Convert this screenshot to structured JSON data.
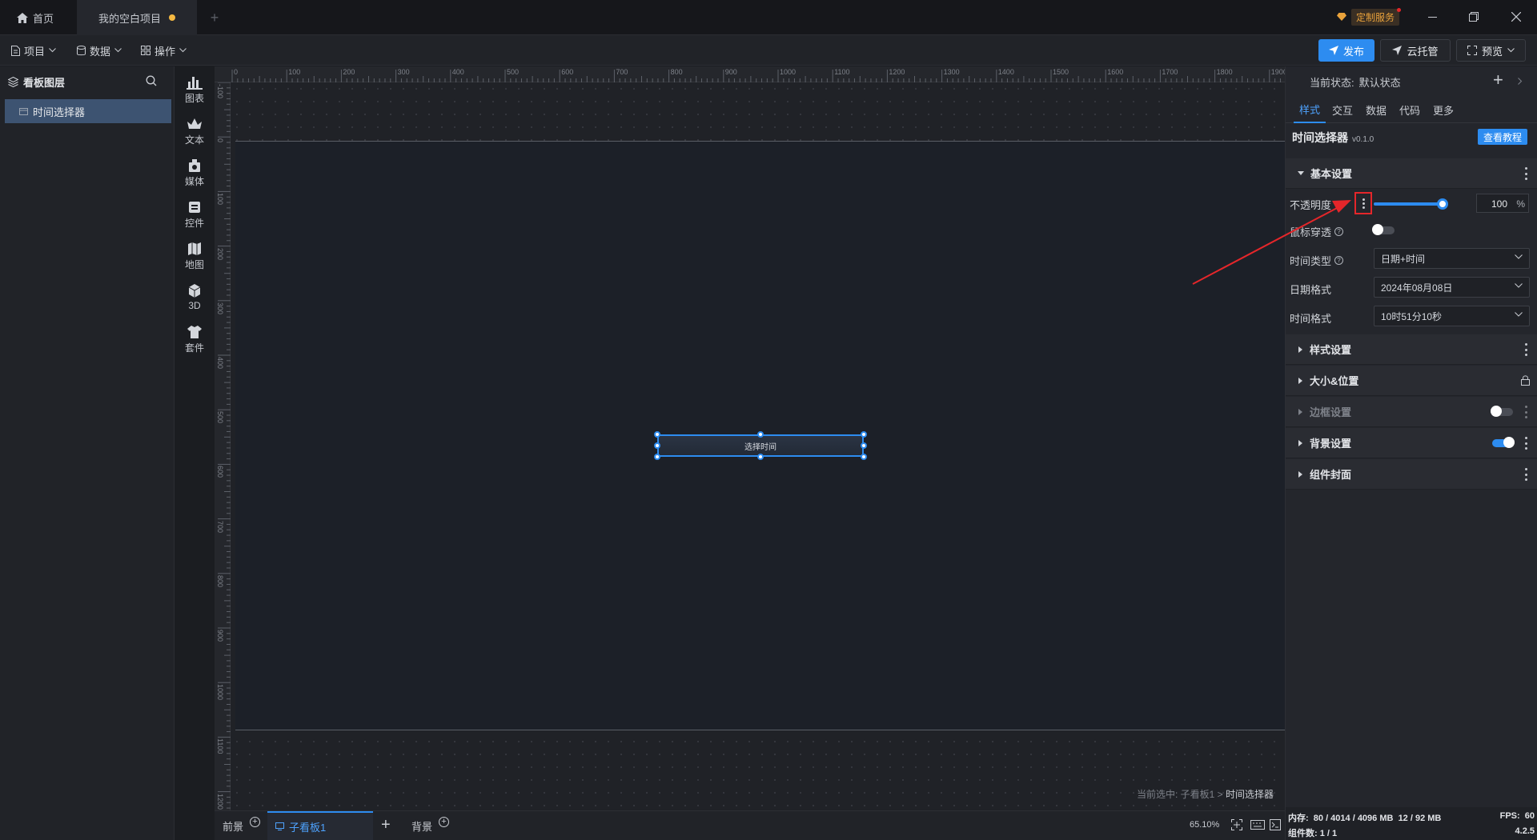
{
  "titlebar": {
    "tabs": [
      {
        "label": "首页"
      },
      {
        "label": "我的空白项目"
      }
    ],
    "custom_service": "定制服务"
  },
  "toolbar": {
    "menus": [
      {
        "label": "项目"
      },
      {
        "label": "数据"
      },
      {
        "label": "操作"
      }
    ],
    "publish": "发布",
    "cloud_host": "云托管",
    "preview": "预览"
  },
  "layers": {
    "title": "看板图层",
    "items": [
      {
        "label": "时间选择器"
      }
    ]
  },
  "tools": [
    {
      "label": "图表",
      "icon": "chart-icon"
    },
    {
      "label": "文本",
      "icon": "text-icon"
    },
    {
      "label": "媒体",
      "icon": "media-icon"
    },
    {
      "label": "控件",
      "icon": "control-icon"
    },
    {
      "label": "地图",
      "icon": "map-icon"
    },
    {
      "label": "3D",
      "icon": "cube-icon"
    },
    {
      "label": "套件",
      "icon": "kit-icon"
    }
  ],
  "ruler": {
    "top_ticks": [
      "0",
      "100",
      "200",
      "300",
      "400",
      "500",
      "600",
      "700",
      "800",
      "900",
      "1000",
      "1100",
      "1200",
      "1300",
      "1400",
      "1500",
      "1600",
      "1700",
      "1800",
      "1900"
    ],
    "left_ticks": [
      "-100",
      "0",
      "100",
      "200",
      "300",
      "400",
      "500",
      "600",
      "700",
      "800",
      "900",
      "1000",
      "1100",
      "1200"
    ]
  },
  "canvas": {
    "widget_text": "选择时间",
    "breadcrumb_prefix": "当前选中: 子看板1 > ",
    "breadcrumb_current": "时间选择器"
  },
  "bottombar": {
    "tabs": [
      {
        "label": "前景"
      },
      {
        "label": "子看板1"
      },
      {
        "label": "背景"
      }
    ],
    "zoom": "65.10%"
  },
  "right": {
    "state_label": "当前状态:",
    "state_value": "默认状态",
    "tabs": [
      {
        "label": "样式"
      },
      {
        "label": "交互"
      },
      {
        "label": "数据"
      },
      {
        "label": "代码"
      },
      {
        "label": "更多"
      }
    ],
    "component_name": "时间选择器",
    "version": "v0.1.0",
    "tutorial": "查看教程",
    "basic_section": "基本设置",
    "opacity_label": "不透明度",
    "opacity_value": "100",
    "opacity_unit": "%",
    "opacity_fraction": 1.0,
    "mouse_through_label": "鼠标穿透",
    "time_type_label": "时间类型",
    "time_type_value": "日期+时间",
    "date_format_label": "日期格式",
    "date_format_value": "2024年08月08日",
    "time_format_label": "时间格式",
    "time_format_value": "10时51分10秒",
    "sections": [
      {
        "label": "样式设置"
      },
      {
        "label": "大小&位置"
      },
      {
        "label": "边框设置"
      },
      {
        "label": "背景设置"
      },
      {
        "label": "组件封面"
      }
    ],
    "footer": {
      "memory": "内存:  80 / 4014 / 4096 MB  12 / 92 MB",
      "fps": "FPS:  60",
      "components": "组件数: 1 / 1",
      "version": "4.2.5"
    }
  },
  "colors": {
    "accent": "#2d8cf0",
    "annotation": "#e5262a"
  }
}
